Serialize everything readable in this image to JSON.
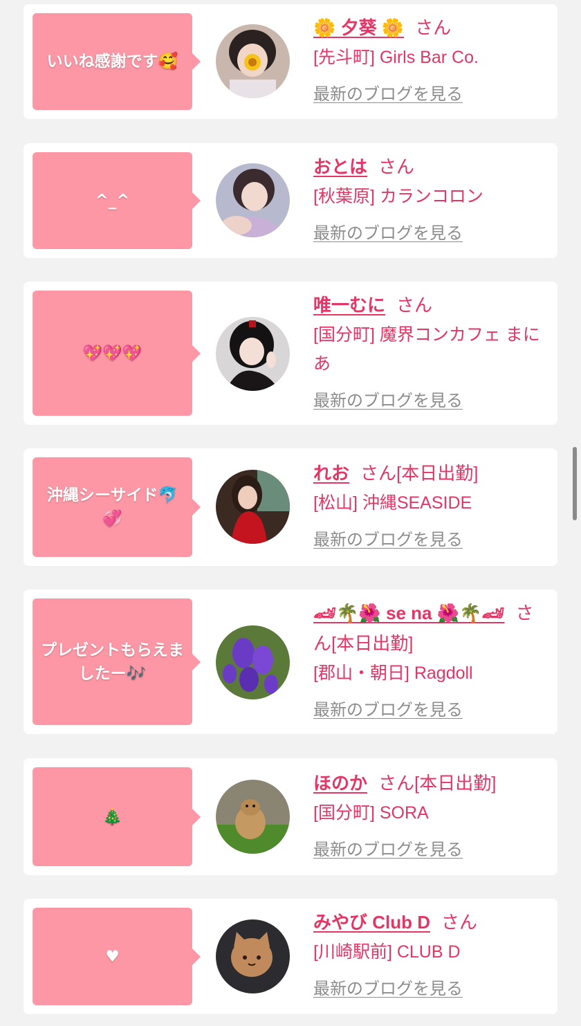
{
  "colors": {
    "page_bg": "#f2f2f2",
    "card_bg": "#ffffff",
    "bubble_bg": "#fe97a5",
    "accent": "#e43565",
    "link_gray": "#8c8c8c"
  },
  "common": {
    "san": "さん",
    "blog_link": "最新のブログを見る"
  },
  "cards": [
    {
      "message": "いいね感謝です🥰",
      "name": "🌼 夕葵 🌼",
      "tag": "",
      "shop": "[先斗町] Girls Bar Co."
    },
    {
      "message": "^_^",
      "name": "おとは",
      "tag": "",
      "shop": "[秋葉原] カランコロン"
    },
    {
      "message": "💖💖💖",
      "name": "唯一むに",
      "tag": "",
      "shop": "[国分町] 魔界コンカフェ まにあ"
    },
    {
      "message": "沖縄シーサイド🐬💞",
      "name": "れお",
      "tag": "[本日出勤]",
      "shop": "[松山] 沖縄SEASIDE"
    },
    {
      "message": "プレゼントもらえましたー🎶",
      "name": "🏎🌴🌺 se na 🌺🌴🏎",
      "tag": "[本日出勤]",
      "shop": "[郡山・朝日] Ragdoll"
    },
    {
      "message": "🎄",
      "name": "ほのか",
      "tag": "[本日出勤]",
      "shop": "[国分町] SORA"
    },
    {
      "message": "♥",
      "name": "みやび Club D",
      "tag": "",
      "shop": "[川崎駅前] CLUB D"
    }
  ]
}
